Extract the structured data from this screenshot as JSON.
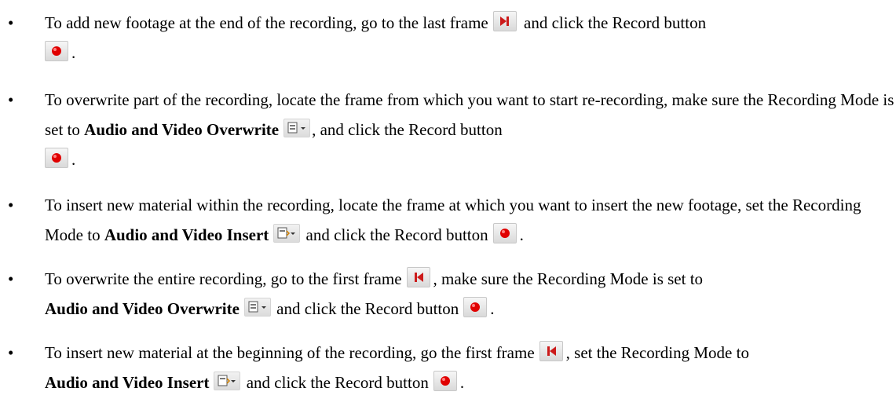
{
  "bullets": [
    {
      "text": [
        "To add new footage at the end of the recording, go to the last frame",
        "and click the Record button",
        "."
      ]
    },
    {
      "text": [
        "To overwrite part of the recording, locate the frame from which you want to start re-recording, make sure the Recording Mode is set to",
        "Audio and Video Overwrite",
        ", and click the Record button",
        "."
      ]
    },
    {
      "text": [
        "To insert new material within the recording, locate the frame at which you want to insert the new footage, set the Recording Mode to",
        "Audio and Video Insert",
        "and click the Record button",
        "."
      ]
    },
    {
      "text": [
        "To overwrite the entire recording, go to the first frame",
        ", make sure the Recording Mode is set to",
        "Audio and Video Overwrite",
        "and click the Record button",
        "."
      ]
    },
    {
      "text": [
        "To insert new material at the beginning of the recording, go the first frame",
        ", set the Recording Mode to",
        "Audio and Video Insert",
        "and click the Record button",
        "."
      ]
    }
  ],
  "bullet_glyph": "•",
  "icons": {
    "last_frame": "last-frame-icon",
    "first_frame": "first-frame-icon",
    "record": "record-icon",
    "overwrite_mode": "overwrite-mode-icon",
    "insert_mode": "insert-mode-icon"
  },
  "colors": {
    "record_red": "#e00000",
    "nav_red": "#cc1a1a"
  }
}
